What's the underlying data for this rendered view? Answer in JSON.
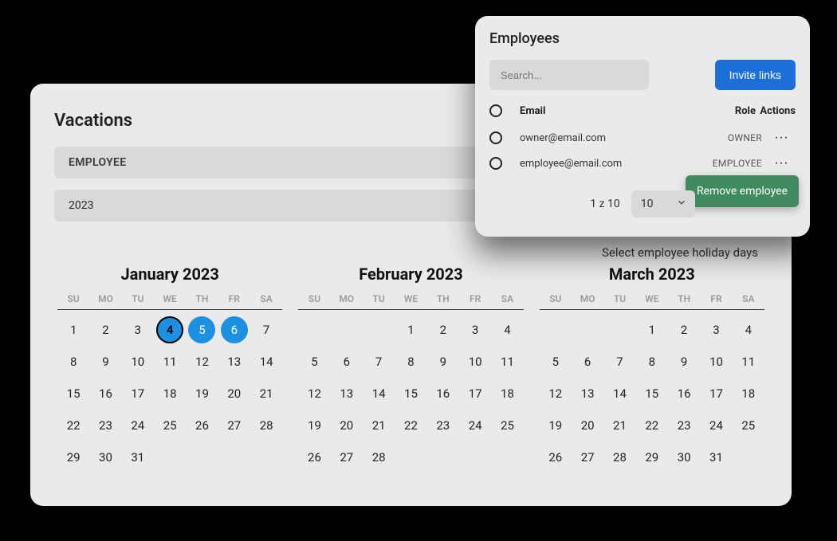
{
  "vacations": {
    "title": "Vacations",
    "employee_filter": "EMPLOYEE",
    "year_filter": "2023",
    "helper_text": "Select employee holiday days",
    "dow": [
      "SU",
      "MO",
      "TU",
      "WE",
      "TH",
      "FR",
      "SA"
    ],
    "months": [
      {
        "title": "January 2023",
        "lead": 0,
        "days": 31,
        "selected": [
          4,
          5,
          6
        ],
        "today": 4
      },
      {
        "title": "February 2023",
        "lead": 3,
        "days": 28,
        "selected": [],
        "today": null
      },
      {
        "title": "March 2023",
        "lead": 3,
        "days": 31,
        "selected": [],
        "today": null
      }
    ]
  },
  "employees": {
    "title": "Employees",
    "search_placeholder": "Search...",
    "invite_label": "Invite links",
    "col_email": "Email",
    "col_role": "Role",
    "col_actions": "Actions",
    "rows": [
      {
        "email": "owner@email.com",
        "role": "OWNER"
      },
      {
        "email": "employee@email.com",
        "role": "EMPLOYEE"
      }
    ],
    "pager_text": "1 z 10",
    "page_size": "10",
    "action_popover": "Remove employee"
  }
}
